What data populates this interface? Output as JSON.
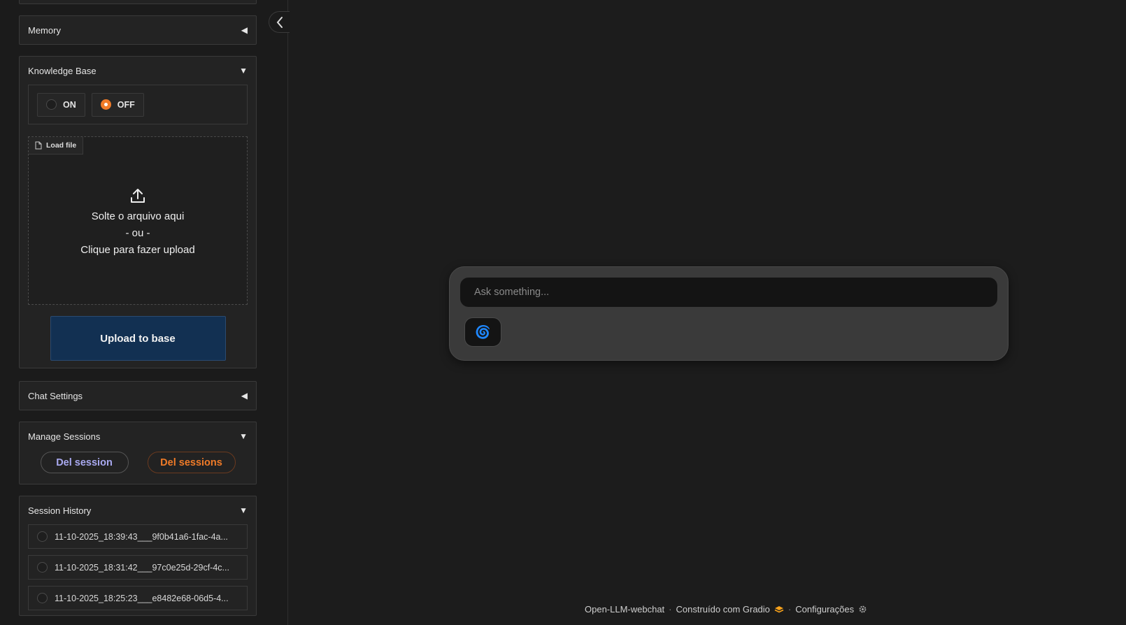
{
  "sidebar": {
    "memory": {
      "title": "Memory",
      "caret": "◀"
    },
    "knowledge_base": {
      "title": "Knowledge Base",
      "caret": "▼",
      "radio_on": "ON",
      "radio_off": "OFF",
      "selected": "OFF",
      "load_file_label": "Load file",
      "drop_line1": "Solte o arquivo aqui",
      "drop_line2": "- ou -",
      "drop_line3": "Clique para fazer upload",
      "upload_button": "Upload to base"
    },
    "chat_settings": {
      "title": "Chat Settings",
      "caret": "◀"
    },
    "manage_sessions": {
      "title": "Manage Sessions",
      "caret": "▼",
      "del_session": "Del session",
      "del_sessions": "Del sessions"
    },
    "session_history": {
      "title": "Session History",
      "caret": "▼",
      "items": [
        "11-10-2025_18:39:43___9f0b41a6-1fac-4a...",
        "11-10-2025_18:31:42___97c0e25d-29cf-4c...",
        "11-10-2025_18:25:23___e8482e68-06d5-4..."
      ]
    }
  },
  "composer": {
    "placeholder": "Ask something...",
    "send_icon": "🌀"
  },
  "footer": {
    "app_name": "Open-LLM-webchat",
    "built_with": "Construído com Gradio",
    "settings": "Configurações",
    "sep": "·"
  },
  "colors": {
    "accent_orange": "#f07b28",
    "upload_blue": "#123052",
    "background": "#1c1c1c"
  }
}
